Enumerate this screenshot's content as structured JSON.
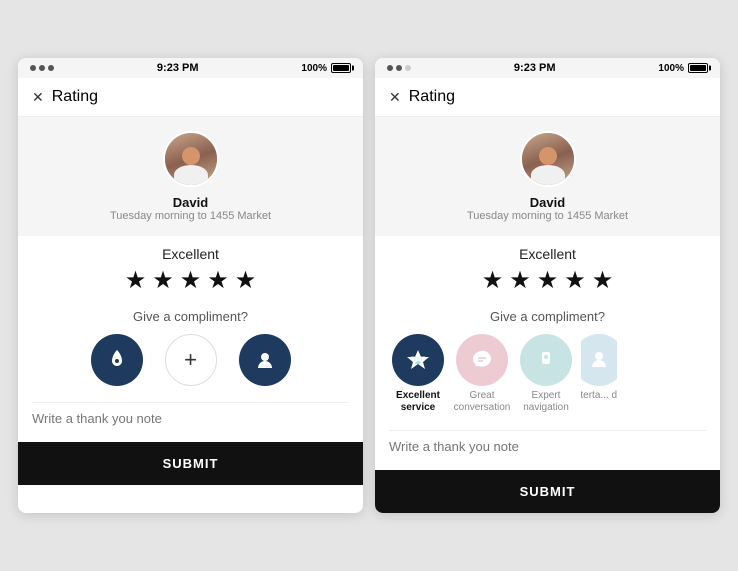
{
  "phone_left": {
    "status_bar": {
      "time": "9:23 PM",
      "battery": "100%"
    },
    "header": {
      "close_label": "✕",
      "title": "Rating"
    },
    "driver": {
      "name": "David",
      "trip": "Tuesday morning to 1455 Market"
    },
    "rating": {
      "label": "Excellent",
      "stars": 5
    },
    "compliment": {
      "question": "Give a compliment?",
      "items": [
        {
          "id": "rocket",
          "icon": "🚀",
          "style": "dark-blue",
          "label": ""
        },
        {
          "id": "add",
          "icon": "+",
          "style": "white-ring",
          "label": ""
        },
        {
          "id": "astronaut",
          "icon": "🚀",
          "style": "dark-blue",
          "label": ""
        }
      ]
    },
    "thank_you": {
      "placeholder": "Write a thank you note"
    },
    "submit": {
      "label": "SUBMIT"
    }
  },
  "phone_right": {
    "status_bar": {
      "time": "9:23 PM",
      "battery": "100%"
    },
    "header": {
      "close_label": "✕",
      "title": "Rating"
    },
    "driver": {
      "name": "David",
      "trip": "Tuesday morning to 1455 Market"
    },
    "rating": {
      "label": "Excellent",
      "stars": 5
    },
    "compliment": {
      "question": "Give a compliment?",
      "items": [
        {
          "id": "excellent-service",
          "icon": "💎",
          "style": "dark-blue",
          "label": "Excellent service",
          "selected": true
        },
        {
          "id": "great-conversation",
          "icon": "👍",
          "style": "pink",
          "label": "Great conversation",
          "selected": false
        },
        {
          "id": "expert-navigation",
          "icon": "📍",
          "style": "teal",
          "label": "Expert navigation",
          "selected": false
        },
        {
          "id": "entertaining-driver",
          "icon": "🎭",
          "style": "light-blue",
          "label": "Enterta... drivi",
          "selected": false
        }
      ]
    },
    "thank_you": {
      "placeholder": "Write a thank you note"
    },
    "submit": {
      "label": "SUBMIT"
    }
  }
}
